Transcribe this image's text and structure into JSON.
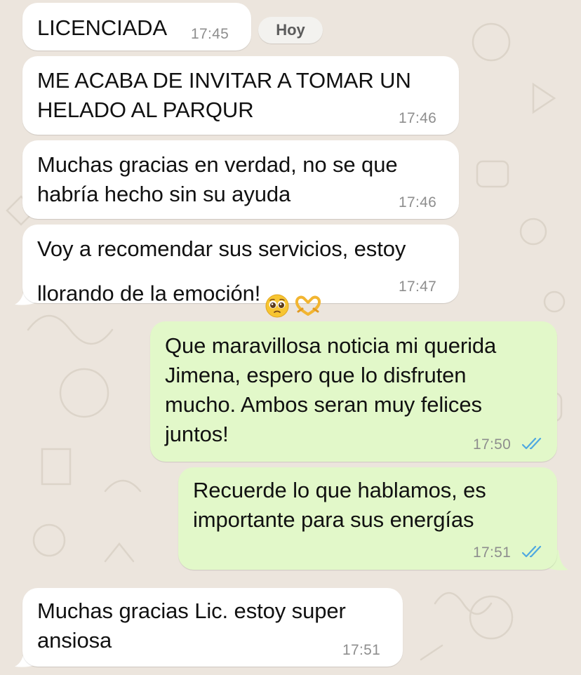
{
  "chat": {
    "day_label": "Hoy",
    "messages": [
      {
        "direction": "incoming",
        "text": "LICENCIADA",
        "time": "17:45"
      },
      {
        "direction": "incoming",
        "text": "ME ACABA DE INVITAR A TOMAR UN\nHELADO AL PARQUR",
        "time": "17:46"
      },
      {
        "direction": "incoming",
        "text": "Muchas gracias en verdad, no se que\nhabría hecho sin su ayuda",
        "time": "17:46"
      },
      {
        "direction": "incoming",
        "text": "Voy a recomendar sus servicios, estoy\nllorando de la emoción!",
        "emojis": [
          "pleading-face-emoji",
          "heart-hands-emoji"
        ],
        "time": "17:47"
      },
      {
        "direction": "outgoing",
        "text": "Que maravillosa noticia mi querida\nJimena, espero que lo disfruten\nmucho. Ambos seran muy felices\njuntos!",
        "time": "17:50",
        "status": "read"
      },
      {
        "direction": "outgoing",
        "text": "Recuerde lo que hablamos, es\nimportante para sus energías",
        "time": "17:51",
        "status": "read"
      },
      {
        "direction": "incoming",
        "text": "Muchas gracias Lic. estoy super\nansiosa",
        "time": "17:51"
      }
    ]
  },
  "colors": {
    "background": "#ece5dd",
    "incoming_bubble": "#ffffff",
    "outgoing_bubble": "#e2f8c9",
    "read_ticks": "#4fa8e0",
    "timestamp": "#8e8e8e"
  }
}
